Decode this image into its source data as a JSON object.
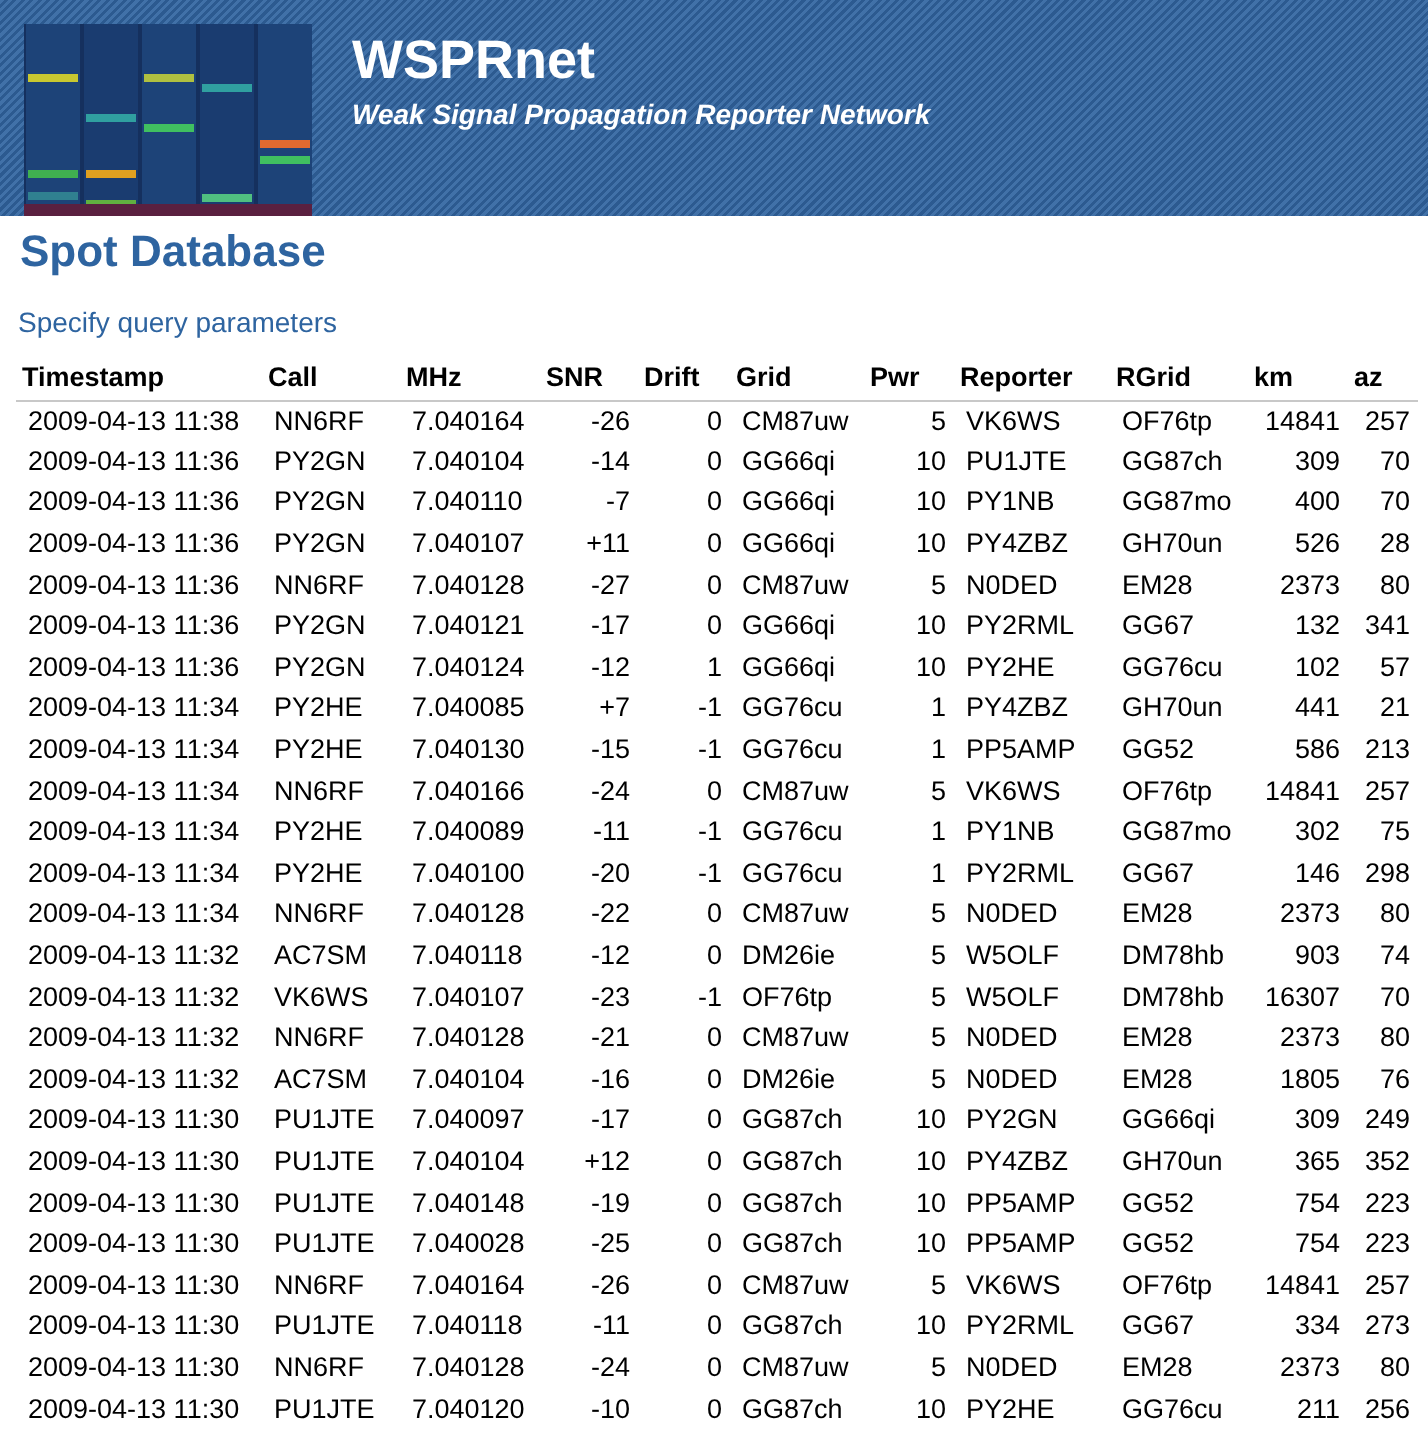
{
  "header": {
    "title": "WSPRnet",
    "subtitle": "Weak Signal Propagation Reporter Network"
  },
  "page_title": "Spot Database",
  "query_link": "Specify query parameters",
  "table": {
    "columns": [
      {
        "label": "Timestamp",
        "kind": "text"
      },
      {
        "label": "Call",
        "kind": "text"
      },
      {
        "label": "MHz",
        "kind": "text"
      },
      {
        "label": "SNR",
        "kind": "number"
      },
      {
        "label": "Drift",
        "kind": "number"
      },
      {
        "label": "Grid",
        "kind": "text"
      },
      {
        "label": "Pwr",
        "kind": "number"
      },
      {
        "label": "Reporter",
        "kind": "text"
      },
      {
        "label": "RGrid",
        "kind": "text"
      },
      {
        "label": "km",
        "kind": "number"
      },
      {
        "label": "az",
        "kind": "number"
      }
    ],
    "rows": [
      [
        "2009-04-13 11:38",
        "NN6RF",
        "7.040164",
        "-26",
        "0",
        "CM87uw",
        "5",
        "VK6WS",
        "OF76tp",
        "14841",
        "257"
      ],
      [
        "2009-04-13 11:36",
        "PY2GN",
        "7.040104",
        "-14",
        "0",
        "GG66qi",
        "10",
        "PU1JTE",
        "GG87ch",
        "309",
        "70"
      ],
      [
        "2009-04-13 11:36",
        "PY2GN",
        "7.040110",
        "-7",
        "0",
        "GG66qi",
        "10",
        "PY1NB",
        "GG87mo",
        "400",
        "70"
      ],
      [
        "2009-04-13 11:36",
        "PY2GN",
        "7.040107",
        "+11",
        "0",
        "GG66qi",
        "10",
        "PY4ZBZ",
        "GH70un",
        "526",
        "28"
      ],
      [
        "2009-04-13 11:36",
        "NN6RF",
        "7.040128",
        "-27",
        "0",
        "CM87uw",
        "5",
        "N0DED",
        "EM28",
        "2373",
        "80"
      ],
      [
        "2009-04-13 11:36",
        "PY2GN",
        "7.040121",
        "-17",
        "0",
        "GG66qi",
        "10",
        "PY2RML",
        "GG67",
        "132",
        "341"
      ],
      [
        "2009-04-13 11:36",
        "PY2GN",
        "7.040124",
        "-12",
        "1",
        "GG66qi",
        "10",
        "PY2HE",
        "GG76cu",
        "102",
        "57"
      ],
      [
        "2009-04-13 11:34",
        "PY2HE",
        "7.040085",
        "+7",
        "-1",
        "GG76cu",
        "1",
        "PY4ZBZ",
        "GH70un",
        "441",
        "21"
      ],
      [
        "2009-04-13 11:34",
        "PY2HE",
        "7.040130",
        "-15",
        "-1",
        "GG76cu",
        "1",
        "PP5AMP",
        "GG52",
        "586",
        "213"
      ],
      [
        "2009-04-13 11:34",
        "NN6RF",
        "7.040166",
        "-24",
        "0",
        "CM87uw",
        "5",
        "VK6WS",
        "OF76tp",
        "14841",
        "257"
      ],
      [
        "2009-04-13 11:34",
        "PY2HE",
        "7.040089",
        "-11",
        "-1",
        "GG76cu",
        "1",
        "PY1NB",
        "GG87mo",
        "302",
        "75"
      ],
      [
        "2009-04-13 11:34",
        "PY2HE",
        "7.040100",
        "-20",
        "-1",
        "GG76cu",
        "1",
        "PY2RML",
        "GG67",
        "146",
        "298"
      ],
      [
        "2009-04-13 11:34",
        "NN6RF",
        "7.040128",
        "-22",
        "0",
        "CM87uw",
        "5",
        "N0DED",
        "EM28",
        "2373",
        "80"
      ],
      [
        "2009-04-13 11:32",
        "AC7SM",
        "7.040118",
        "-12",
        "0",
        "DM26ie",
        "5",
        "W5OLF",
        "DM78hb",
        "903",
        "74"
      ],
      [
        "2009-04-13 11:32",
        "VK6WS",
        "7.040107",
        "-23",
        "-1",
        "OF76tp",
        "5",
        "W5OLF",
        "DM78hb",
        "16307",
        "70"
      ],
      [
        "2009-04-13 11:32",
        "NN6RF",
        "7.040128",
        "-21",
        "0",
        "CM87uw",
        "5",
        "N0DED",
        "EM28",
        "2373",
        "80"
      ],
      [
        "2009-04-13 11:32",
        "AC7SM",
        "7.040104",
        "-16",
        "0",
        "DM26ie",
        "5",
        "N0DED",
        "EM28",
        "1805",
        "76"
      ],
      [
        "2009-04-13 11:30",
        "PU1JTE",
        "7.040097",
        "-17",
        "0",
        "GG87ch",
        "10",
        "PY2GN",
        "GG66qi",
        "309",
        "249"
      ],
      [
        "2009-04-13 11:30",
        "PU1JTE",
        "7.040104",
        "+12",
        "0",
        "GG87ch",
        "10",
        "PY4ZBZ",
        "GH70un",
        "365",
        "352"
      ],
      [
        "2009-04-13 11:30",
        "PU1JTE",
        "7.040148",
        "-19",
        "0",
        "GG87ch",
        "10",
        "PP5AMP",
        "GG52",
        "754",
        "223"
      ],
      [
        "2009-04-13 11:30",
        "PU1JTE",
        "7.040028",
        "-25",
        "0",
        "GG87ch",
        "10",
        "PP5AMP",
        "GG52",
        "754",
        "223"
      ],
      [
        "2009-04-13 11:30",
        "NN6RF",
        "7.040164",
        "-26",
        "0",
        "CM87uw",
        "5",
        "VK6WS",
        "OF76tp",
        "14841",
        "257"
      ],
      [
        "2009-04-13 11:30",
        "PU1JTE",
        "7.040118",
        "-11",
        "0",
        "GG87ch",
        "10",
        "PY2RML",
        "GG67",
        "334",
        "273"
      ],
      [
        "2009-04-13 11:30",
        "NN6RF",
        "7.040128",
        "-24",
        "0",
        "CM87uw",
        "5",
        "N0DED",
        "EM28",
        "2373",
        "80"
      ],
      [
        "2009-04-13 11:30",
        "PU1JTE",
        "7.040120",
        "-10",
        "0",
        "GG87ch",
        "10",
        "PY2HE",
        "GG76cu",
        "211",
        "256"
      ]
    ]
  }
}
